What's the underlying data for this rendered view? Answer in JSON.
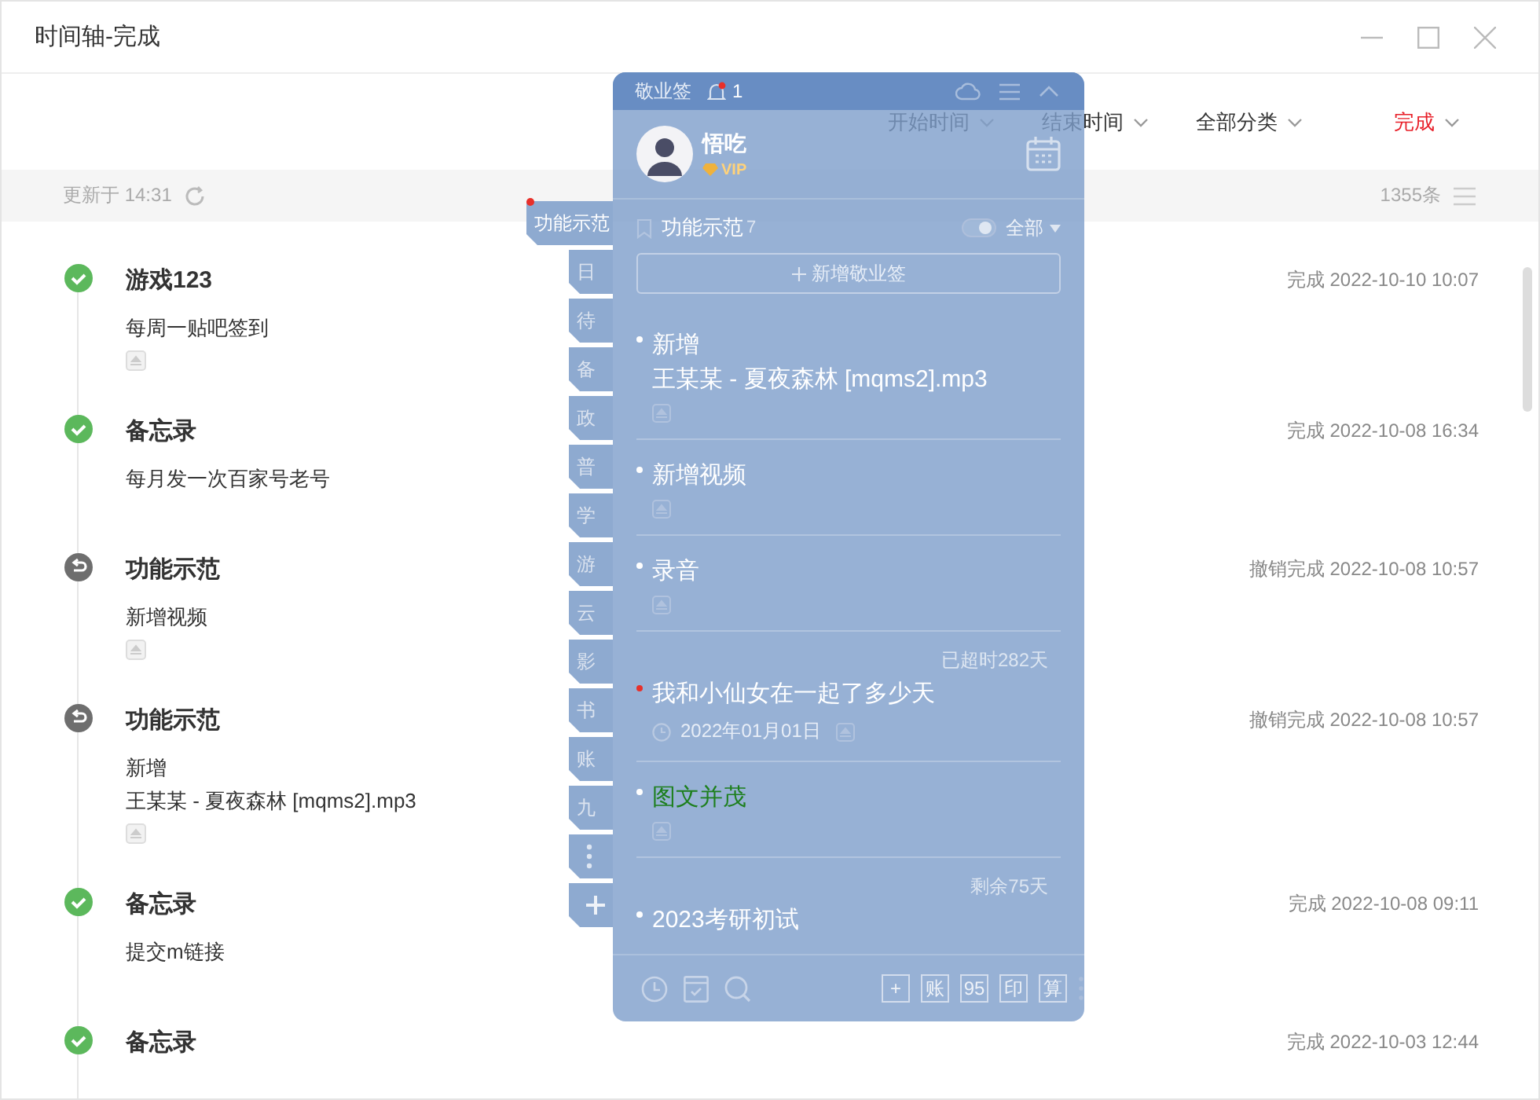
{
  "window": {
    "title": "时间轴-完成"
  },
  "filters": [
    {
      "label": "开始时间",
      "selected": false
    },
    {
      "label": "结束时间",
      "selected": false
    },
    {
      "label": "全部分类",
      "selected": false
    },
    {
      "label": "完成",
      "selected": true
    }
  ],
  "status_bar": {
    "updated": "更新于 14:31",
    "count": "1355条"
  },
  "timeline": [
    {
      "kind": "done",
      "title": "游戏123",
      "lines": [
        "每周一贴吧签到"
      ],
      "attachment": true,
      "time": "完成 2022-10-10 10:07"
    },
    {
      "kind": "done",
      "title": "备忘录",
      "lines": [
        "每月发一次百家号老号"
      ],
      "attachment": false,
      "time": "完成 2022-10-08 16:34"
    },
    {
      "kind": "undone",
      "title": "功能示范",
      "lines": [
        "新增视频"
      ],
      "attachment": true,
      "time": "撤销完成 2022-10-08 10:57"
    },
    {
      "kind": "undone",
      "title": "功能示范",
      "lines": [
        "新增",
        "王某某 - 夏夜森林 [mqms2].mp3"
      ],
      "attachment": true,
      "time": "撤销完成 2022-10-08 10:57"
    },
    {
      "kind": "done",
      "title": "备忘录",
      "lines": [
        "提交m链接"
      ],
      "attachment": false,
      "time": "完成 2022-10-08 09:11"
    },
    {
      "kind": "done",
      "title": "备忘录",
      "attachment": false,
      "time": "完成 2022-10-03 12:44"
    }
  ],
  "widget": {
    "app_name": "敬业签",
    "notification_count": "1",
    "user": {
      "name": "悟吃",
      "badge": "VIP"
    },
    "side_tabs": [
      {
        "label": "功能示范",
        "selected": true,
        "unread": true
      },
      {
        "label": "日",
        "selected": false,
        "unread": false
      },
      {
        "label": "待",
        "selected": false,
        "unread": false
      },
      {
        "label": "备",
        "selected": false,
        "unread": false
      },
      {
        "label": "政",
        "selected": false,
        "unread": false
      },
      {
        "label": "普",
        "selected": false,
        "unread": false
      },
      {
        "label": "学",
        "selected": false,
        "unread": false
      },
      {
        "label": "游",
        "selected": false,
        "unread": false
      },
      {
        "label": "云",
        "selected": false,
        "unread": false
      },
      {
        "label": "影",
        "selected": false,
        "unread": false
      },
      {
        "label": "书",
        "selected": false,
        "unread": false
      },
      {
        "label": "账",
        "selected": false,
        "unread": false
      },
      {
        "label": "九",
        "selected": false,
        "unread": false
      }
    ],
    "category": {
      "name": "功能示范",
      "count": "7",
      "toggle_on": true,
      "scope": "全部"
    },
    "add_button": "新增敬业签",
    "notes": [
      {
        "color": "#ffffff",
        "highlight": false,
        "lines": [
          "新增",
          "王某某 - 夏夜森林 [mqms2].mp3"
        ],
        "attachment": true
      },
      {
        "color": "#ffffff",
        "highlight": false,
        "lines": [
          "新增视频"
        ],
        "attachment": true
      },
      {
        "color": "#ffffff",
        "highlight": false,
        "lines": [
          "录音"
        ],
        "attachment": true
      },
      {
        "tag": "已超时282天",
        "color": "#e8302a",
        "highlight": false,
        "lines": [
          "我和小仙女在一起了多少天"
        ],
        "date": "2022年01月01日",
        "attachment": true
      },
      {
        "color": "#ffffff",
        "highlight": true,
        "lines": [
          "图文并茂"
        ],
        "attachment": true
      },
      {
        "tag": "剩余75天",
        "color": "#ffffff",
        "highlight": false,
        "lines": [
          "2023考研初试"
        ],
        "attachment": false
      }
    ],
    "footer_buttons": [
      "+",
      "账",
      "95",
      "印",
      "算"
    ]
  }
}
